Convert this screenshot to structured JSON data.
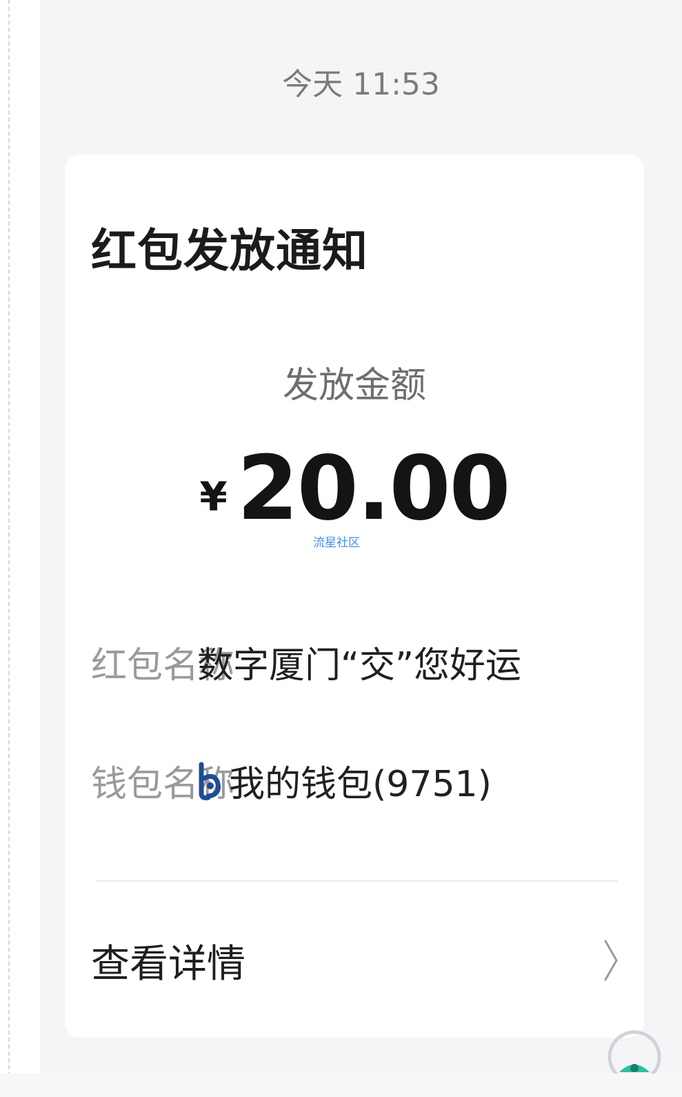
{
  "timestamp": "今天 11:53",
  "card": {
    "title": "红包发放通知",
    "amount_label": "发放金额",
    "currency_symbol": "¥",
    "amount": "20.00",
    "watermark": "流星社区",
    "fields": [
      {
        "label": "红包名称",
        "value": "数字厦门“交”您好运"
      },
      {
        "label": "钱包名称",
        "value": "我的钱包(9751)",
        "icon": "bank-wallet-logo-icon"
      }
    ],
    "details_label": "查看详情",
    "details_icon": "chevron-right-icon"
  },
  "floating_button_icon": "floating-assistant-icon",
  "colors": {
    "background": "#f4f5f7",
    "card": "#ffffff",
    "watermark": "#3f8ee8",
    "wallet_logo": "#1e4b97",
    "floating_button": "#2bbfa0"
  }
}
